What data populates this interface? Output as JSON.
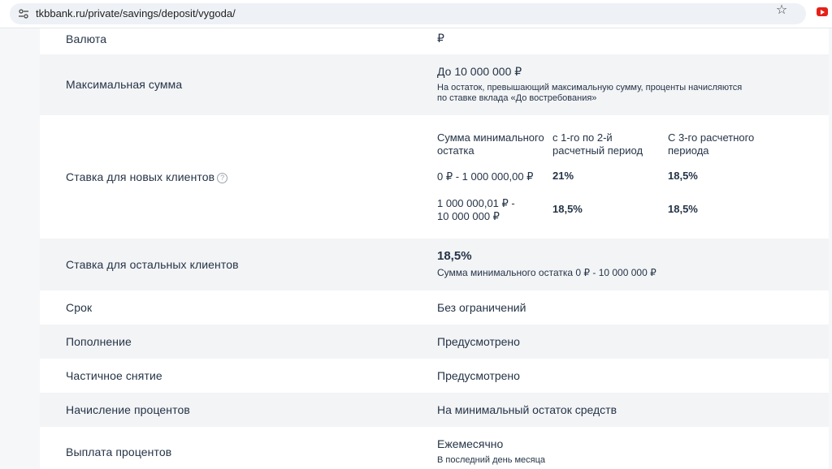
{
  "browser": {
    "url": "tkbbank.ru/private/savings/deposit/vygoda/"
  },
  "rows": {
    "currency": {
      "label": "Валюта",
      "value": "₽"
    },
    "max_sum": {
      "label": "Максимальная сумма",
      "value": "До 10 000 000 ₽",
      "note_line1": "На остаток, превышающий максимальную сумму, проценты начисляются",
      "note_line2": "по ставке вклада «До востребования»"
    },
    "new_clients": {
      "label": "Ставка для новых клиентов",
      "help_icon": "?",
      "headers": {
        "col1_line1": "Сумма минимального",
        "col1_line2": "остатка",
        "col2_line1": "с 1-го по 2-й",
        "col2_line2": "расчетный период",
        "col3_line1": "С 3-го расчетного",
        "col3_line2": "периода"
      },
      "rows": [
        {
          "range_line1": "0 ₽ - 1 000 000,00 ₽",
          "range_line2": "",
          "rate1": "21%",
          "rate2": "18,5%"
        },
        {
          "range_line1": "1 000 000,01 ₽ -",
          "range_line2": "10 000 000 ₽",
          "rate1": "18,5%",
          "rate2": "18,5%"
        }
      ]
    },
    "other_clients": {
      "label": "Ставка для остальных клиентов",
      "rate": "18,5%",
      "note": "Сумма минимального остатка 0 ₽ - 10 000 000 ₽"
    },
    "term": {
      "label": "Срок",
      "value": "Без ограничений"
    },
    "topup": {
      "label": "Пополнение",
      "value": "Предусмотрено"
    },
    "withdrawal": {
      "label": "Частичное снятие",
      "value": "Предусмотрено"
    },
    "accrual": {
      "label": "Начисление процентов",
      "value": "На минимальный остаток средств"
    },
    "payout": {
      "label": "Выплата процентов",
      "value": "Ежемесячно",
      "note": "В последний день месяца"
    }
  }
}
